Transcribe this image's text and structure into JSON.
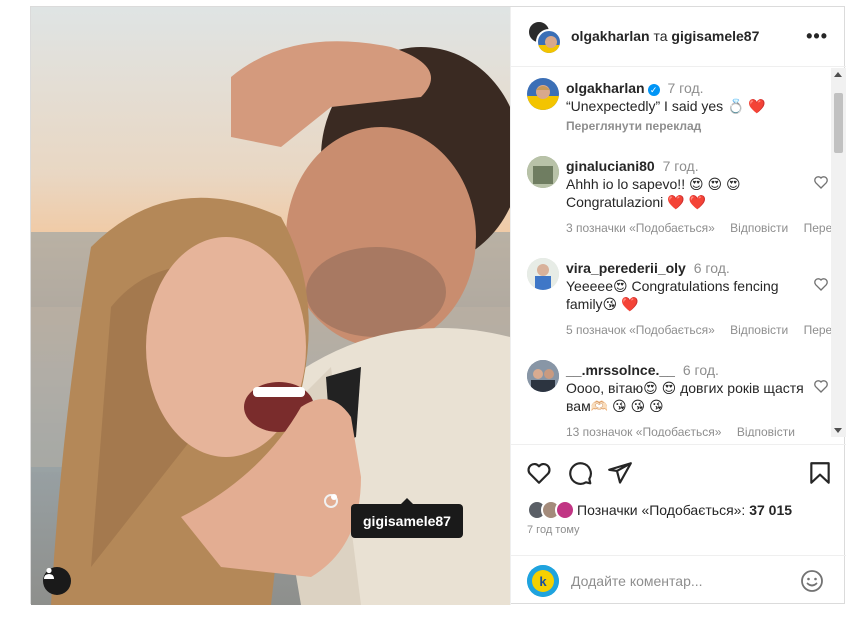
{
  "header": {
    "author": "olgakharlan",
    "connector": "та",
    "coauthor": "gigisamele87",
    "more_label": "•••"
  },
  "photo": {
    "tag_label": "gigisamele87"
  },
  "comments": [
    {
      "user": "olgakharlan",
      "verified": true,
      "time": "7 год.",
      "text": "“Unexpectedly” I said yes 💍 ❤️",
      "meta": [
        "Переглянути переклад"
      ]
    },
    {
      "user": "ginaluciani80",
      "time": "7 год.",
      "text": "Ahhh io lo sapevo!! 😍 😍 😍 Congratulazioni ❤️ ❤️",
      "meta": [
        "3 позначки «Подобається»",
        "Відповісти",
        "Переглянути переклад"
      ]
    },
    {
      "user": "vira_perederii_oly",
      "time": "6 год.",
      "text": "Yeeeee😍 Congratulations fencing family😘 ❤️",
      "meta": [
        "5 позначок «Подобається»",
        "Відповісти",
        "Переглянути переклад"
      ]
    },
    {
      "user": "__.mrssolnce.__",
      "time": "6 год.",
      "text": "Оооо, вітаю😍 😍 довгих років щастя вам🫶🏻 😘 😘 😘",
      "meta": [
        "13 позначок «Подобається»",
        "Відповісти"
      ]
    }
  ],
  "likes": {
    "label": "Позначки «Подобається»:",
    "count": "37 015"
  },
  "post_time": "7 год тому",
  "add_comment": {
    "placeholder": "Додайте коментар..."
  },
  "colors": {
    "text": "#262626",
    "muted": "#8e8e8e",
    "verified": "#0095f6",
    "heart": "#ed4956"
  },
  "icons": [
    "heart-icon",
    "comment-icon",
    "share-icon",
    "bookmark-icon",
    "emoji-icon",
    "user-tag-icon",
    "more-icon",
    "verified-icon"
  ]
}
